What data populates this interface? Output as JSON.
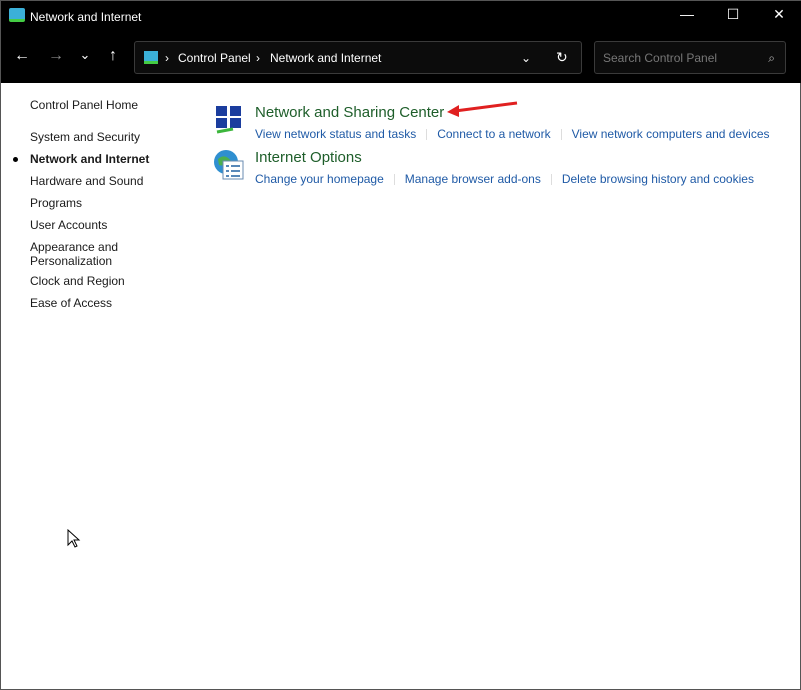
{
  "window": {
    "title": "Network and Internet",
    "icon": "control-panel-network-icon"
  },
  "controls": {
    "minimize": "—",
    "maximize": "☐",
    "close": "✕"
  },
  "nav": {
    "back": "←",
    "forward": "→",
    "recent": "⌄",
    "up": "↑"
  },
  "address": {
    "crumbs": [
      "Control Panel",
      "Network and Internet"
    ],
    "separator": "›",
    "dropdown": "⌄",
    "refresh": "↻"
  },
  "search": {
    "placeholder": "Search Control Panel",
    "icon": "⌕"
  },
  "sidebar": {
    "items": [
      {
        "label": "Control Panel Home"
      },
      {
        "label": "System and Security"
      },
      {
        "label": "Network and Internet",
        "selected": true
      },
      {
        "label": "Hardware and Sound"
      },
      {
        "label": "Programs"
      },
      {
        "label": "User Accounts"
      },
      {
        "label": "Appearance and Personalization"
      },
      {
        "label": "Clock and Region"
      },
      {
        "label": "Ease of Access"
      }
    ]
  },
  "categories": [
    {
      "title": "Network and Sharing Center",
      "icon": "network-sharing-icon",
      "links": [
        "View network status and tasks",
        "Connect to a network",
        "View network computers and devices"
      ]
    },
    {
      "title": "Internet Options",
      "icon": "internet-options-icon",
      "links": [
        "Change your homepage",
        "Manage browser add-ons",
        "Delete browsing history and cookies"
      ]
    }
  ],
  "colors": {
    "heading": "#1e5e2a",
    "link": "#1f5aa6",
    "annotation_arrow": "#e02020"
  }
}
